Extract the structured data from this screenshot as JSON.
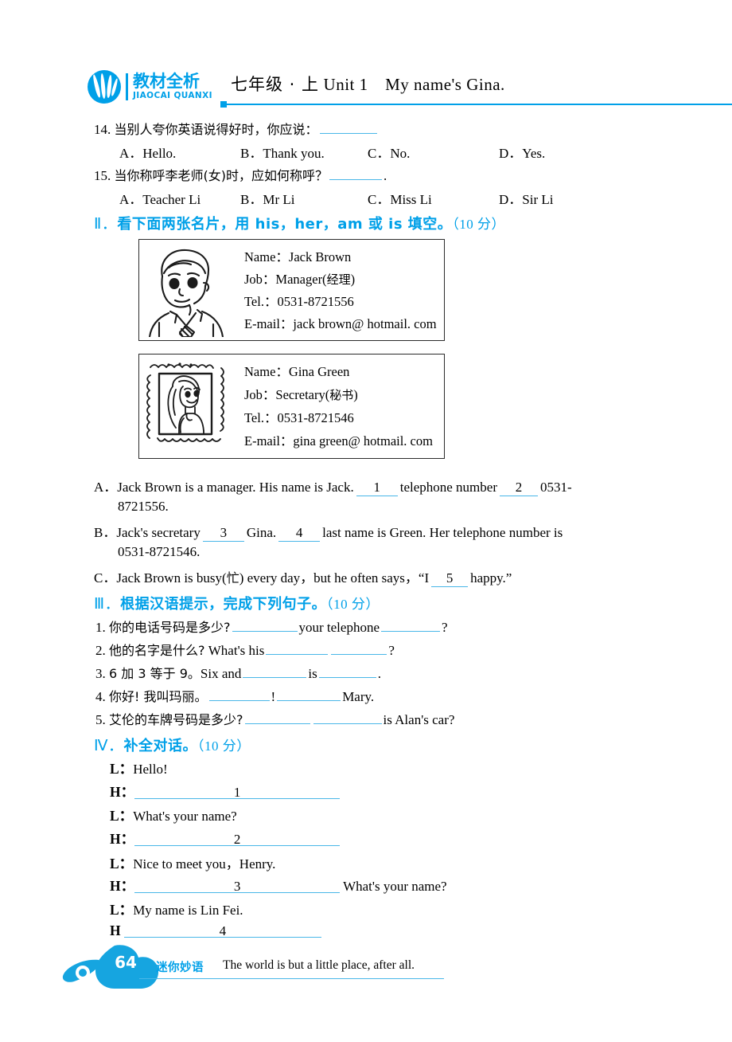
{
  "header": {
    "logo_cn": "教材全析",
    "logo_en": "JIAOCAI QUANXI",
    "title_cn": "七年级 · 上",
    "title_en": "Unit 1 My name's Gina."
  },
  "questions": [
    {
      "num": "14.",
      "stem_cn": "当别人夸你英语说得好时，你应说：",
      "tail": "",
      "options": [
        "A．Hello.",
        "B．Thank you.",
        "C．No.",
        "D．Yes."
      ]
    },
    {
      "num": "15.",
      "stem_cn": "当你称呼李老师(女)时，应如何称呼？",
      "tail": ".",
      "options": [
        "A．Teacher Li",
        "B．Mr Li",
        "C．Miss Li",
        "D．Sir Li"
      ]
    }
  ],
  "section2": {
    "heading_rn": "Ⅱ．",
    "heading_text": "看下面两张名片，用 his，her，am 或 is 填空。",
    "heading_points": "（10 分）",
    "cards": [
      {
        "picture": "man-portrait",
        "rows": [
          {
            "label": "Name：",
            "value": "Jack Brown"
          },
          {
            "label": "Job：",
            "value": "Manager(",
            "zh": "经理",
            "value_end": ")"
          },
          {
            "label": "Tel.：",
            "value": "0531-8721556"
          },
          {
            "label": "E-mail：",
            "value": "jack brown@ hotmail. com"
          }
        ]
      },
      {
        "picture": "girl-stamp",
        "rows": [
          {
            "label": "Name：",
            "value": "Gina Green"
          },
          {
            "label": "Job：",
            "value": "Secretary(",
            "zh": "秘书",
            "value_end": ")"
          },
          {
            "label": "Tel.：",
            "value": "0531-8721546"
          },
          {
            "label": "E-mail：",
            "value": "gina green@ hotmail. com"
          }
        ]
      }
    ],
    "items": [
      {
        "letter": "A．",
        "line1_a": "Jack Brown is a manager. His name is Jack.",
        "blank1": "1",
        "line1_b": "telephone number",
        "blank2": "2",
        "line1_c": "0531-",
        "line2": "8721556."
      },
      {
        "letter": "B．",
        "line1_a": "Jack's secretary",
        "blank1": "3",
        "line1_b": "Gina.",
        "blank2": "4",
        "line1_c": "last name is Green. Her telephone number is",
        "line2": "0531-8721546."
      },
      {
        "letter": "C．",
        "line1_a": "Jack Brown is busy(",
        "zh": "忙",
        "line1_a2": ") every day，but he often says，“I",
        "blank1": "5",
        "line1_b": "happy.”"
      }
    ]
  },
  "section3": {
    "heading_rn": "Ⅲ．",
    "heading_text": "根据汉语提示，完成下列句子。",
    "heading_points": "（10 分）",
    "items": [
      {
        "num": "1.",
        "cn": "你的电话号码是多少?",
        "mid": "your telephone",
        "tail": "?"
      },
      {
        "num": "2.",
        "cn": "他的名字是什么?",
        "en_lead": "What's his",
        "tail": "?"
      },
      {
        "num": "3.",
        "cn": "6 加 3 等于 9。",
        "en_lead": "Six and",
        "mid": "is",
        "tail": "."
      },
      {
        "num": "4.",
        "cn": "你好! 我叫玛丽。",
        "mid": "!",
        "tail": "Mary."
      },
      {
        "num": "5.",
        "cn": "艾伦的车牌号码是多少?",
        "tail": "is Alan's car?"
      }
    ]
  },
  "section4": {
    "heading_rn": "Ⅳ．",
    "heading_text": "补全对话。",
    "heading_points": "（10 分）",
    "lines": [
      {
        "speaker": "L：",
        "text": "Hello!"
      },
      {
        "speaker": "H：",
        "blank": "1"
      },
      {
        "speaker": "L：",
        "text": "What's your name?"
      },
      {
        "speaker": "H：",
        "blank": "2"
      },
      {
        "speaker": "L：",
        "text": "Nice to meet you，Henry."
      },
      {
        "speaker": "H：",
        "blank": "3",
        "after": "What's your name?"
      },
      {
        "speaker": "L：",
        "text": "My name is Lin Fei."
      },
      {
        "speaker": "H",
        "blank": "4"
      }
    ]
  },
  "footer": {
    "page_number": "64",
    "tag": "迷你妙语",
    "quote": "The world is but a little place, after all."
  },
  "colors": {
    "accent": "#00a0e8",
    "blank_rule": "#49b7e8",
    "text": "#000000"
  }
}
